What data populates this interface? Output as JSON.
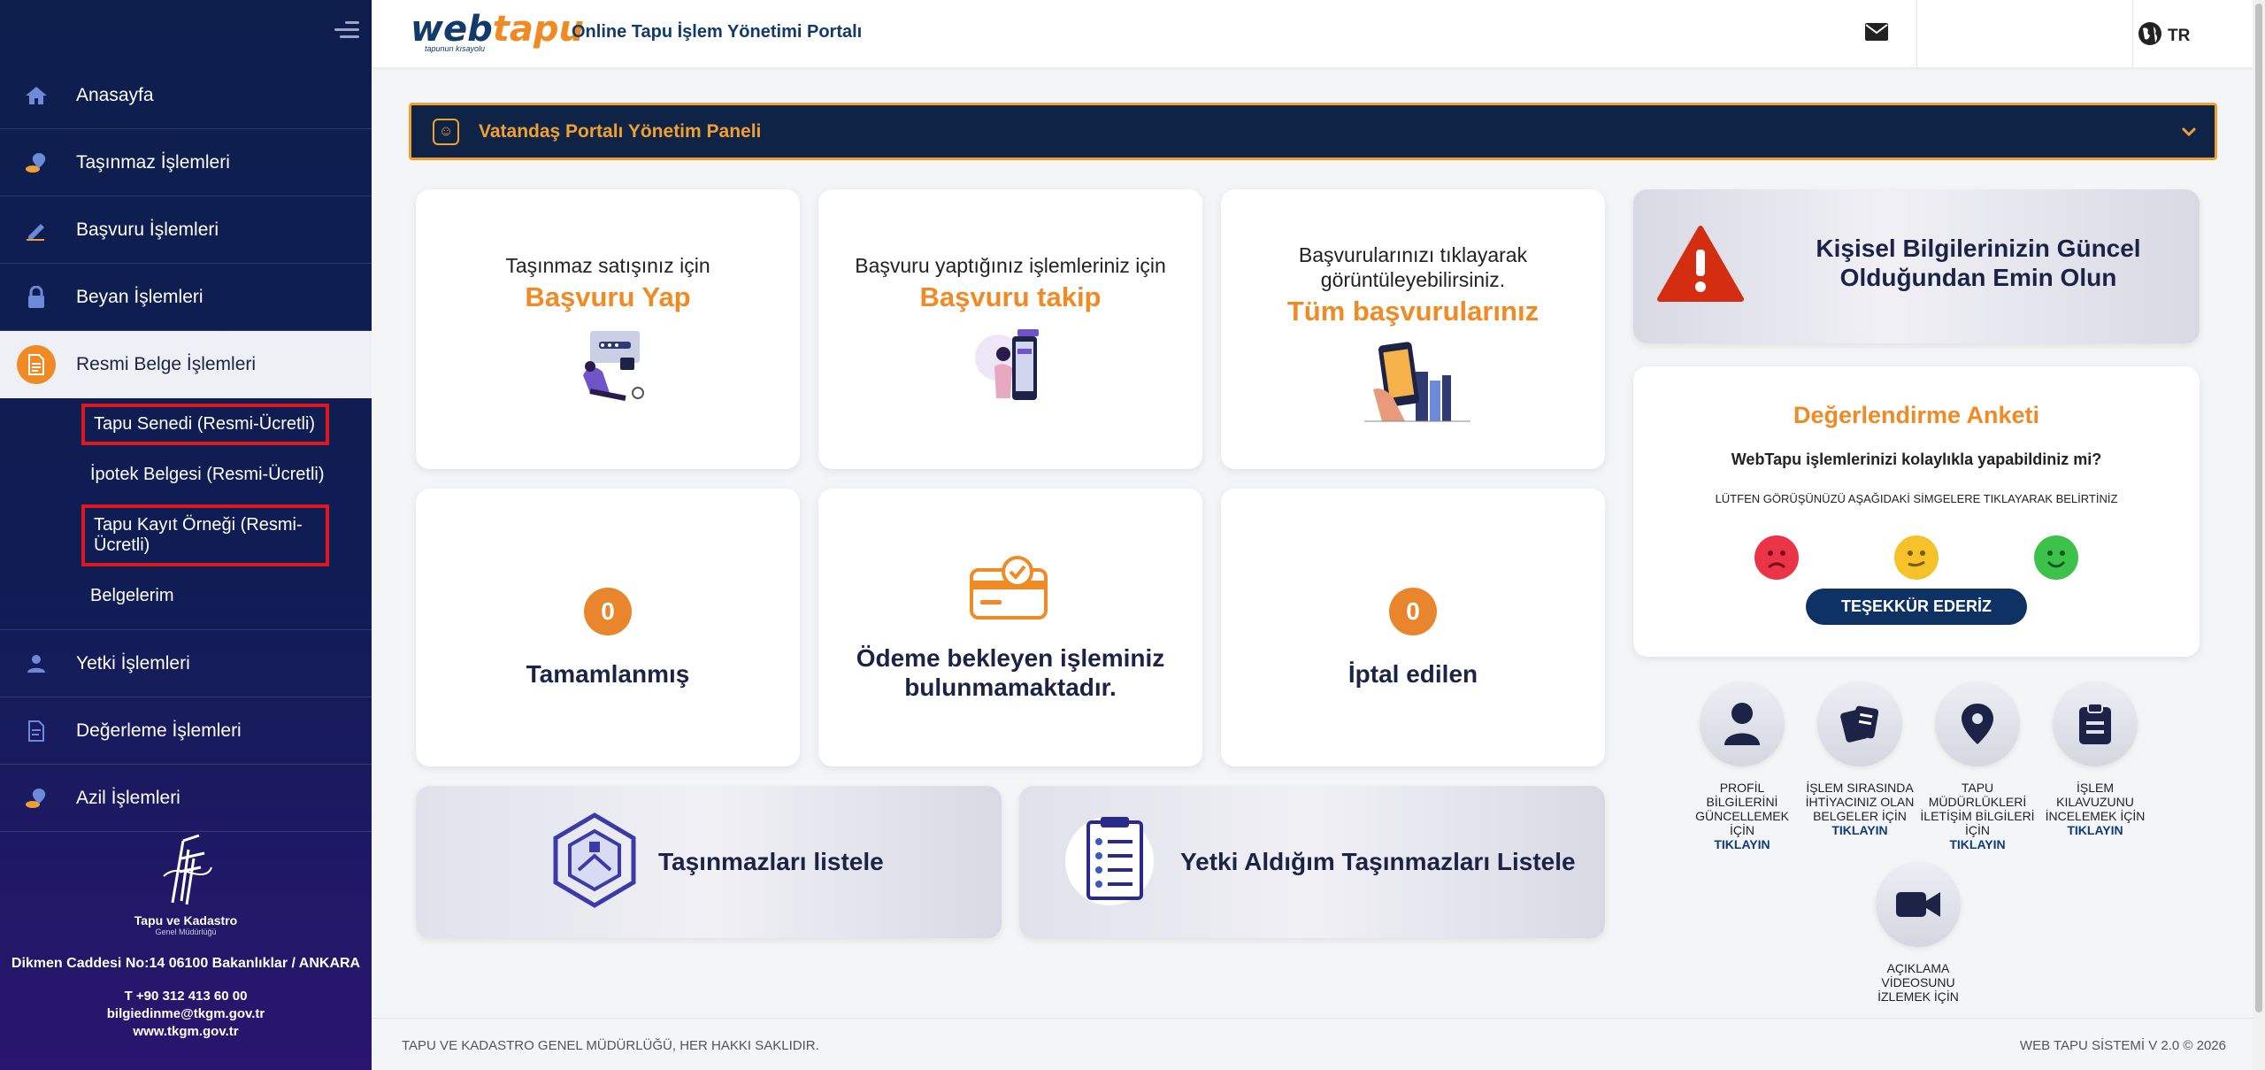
{
  "header": {
    "brand_web": "web",
    "brand_tapu": "tapu",
    "brand_tag": "tapunun kısayolu",
    "portal_title": "Online Tapu İşlem Yönetimi Portalı",
    "lang": "TR"
  },
  "sidebar": {
    "items": [
      {
        "label": "Anasayfa",
        "icon": "home-icon"
      },
      {
        "label": "Taşınmaz İşlemleri",
        "icon": "location-pin-icon"
      },
      {
        "label": "Başvuru İşlemleri",
        "icon": "pen-icon"
      },
      {
        "label": "Beyan İşlemleri",
        "icon": "lock-icon"
      },
      {
        "label": "Resmi Belge İşlemleri",
        "icon": "document-icon"
      },
      {
        "label": "Yetki İşlemleri",
        "icon": "user-icon"
      },
      {
        "label": "Değerleme İşlemleri",
        "icon": "report-icon"
      },
      {
        "label": "Azil İşlemleri",
        "icon": "location-pin-icon"
      }
    ],
    "sub_items": [
      "Tapu Senedi (Resmi-Ücretli)",
      "İpotek Belgesi (Resmi-Ücretli)",
      "Tapu Kayıt Örneği (Resmi-Ücretli)",
      "Belgelerim"
    ],
    "footer": {
      "org_name": "Tapu ve Kadastro",
      "org_sub": "Genel Müdürlüğü",
      "address": "Dikmen Caddesi No:14 06100 Bakanlıklar / ANKARA",
      "phone": "T +90 312 413 60 00",
      "email": "bilgiedinme@tkgm.gov.tr",
      "web": "www.tkgm.gov.tr"
    }
  },
  "panel": {
    "label": "Vatandaş Portalı Yönetim Paneli"
  },
  "cards": {
    "apply": {
      "small": "Taşınmaz satışınız için",
      "big": "Başvuru Yap"
    },
    "track": {
      "small": "Başvuru yaptığınız işlemleriniz için",
      "big": "Başvuru takip"
    },
    "all": {
      "small": "Başvurularınızı tıklayarak görüntüleyebilirsiniz.",
      "big": "Tüm başvurularınız"
    },
    "completed": {
      "count": "0",
      "label": "Tamamlanmış"
    },
    "payment": {
      "label": "Ödeme bekleyen işleminiz bulunmamaktadır."
    },
    "cancelled": {
      "count": "0",
      "label": "İptal edilen"
    }
  },
  "lists": {
    "properties": "Taşınmazları listele",
    "authorized": "Yetki Aldığım Taşınmazları Listele"
  },
  "warning": {
    "text": "Kişisel Bilgilerinizin Güncel Olduğundan Emin Olun"
  },
  "survey": {
    "title": "Değerlendirme Anketi",
    "question": "WebTapu işlemlerinizi kolaylıkla yapabildiniz mi?",
    "hint": "LÜTFEN GÖRÜŞÜNÜZÜ AŞAĞIDAKİ SİMGELERE TIKLAYARAK BELİRTİNİZ",
    "button": "TEŞEKKÜR EDERİZ"
  },
  "quick_links": [
    {
      "text": "PROFİL BİLGİLERİNİ GÜNCELLEMEK İÇİN",
      "link": "TIKLAYIN"
    },
    {
      "text": "İŞLEM SIRASINDA İHTİYACINIZ OLAN BELGELER İÇİN",
      "link": "TIKLAYIN"
    },
    {
      "text": "TAPU MÜDÜRLÜKLERİ İLETİŞİM BİLGİLERİ İÇİN",
      "link": "TIKLAYIN"
    },
    {
      "text": "İŞLEM KILAVUZUNU İNCELEMEK İÇİN",
      "link": "TIKLAYIN"
    },
    {
      "text": "AÇIKLAMA VİDEOSUNU İZLEMEK İÇİN",
      "link": ""
    }
  ],
  "footer": {
    "left": "TAPU VE KADASTRO GENEL MÜDÜRLÜĞÜ, HER HAKKI SAKLIDIR.",
    "right": "WEB TAPU SİSTEMİ V 2.0 © 2026"
  },
  "colors": {
    "accent": "#f08a24",
    "navy": "#0f2346",
    "highlight_box": "#e0181b"
  }
}
